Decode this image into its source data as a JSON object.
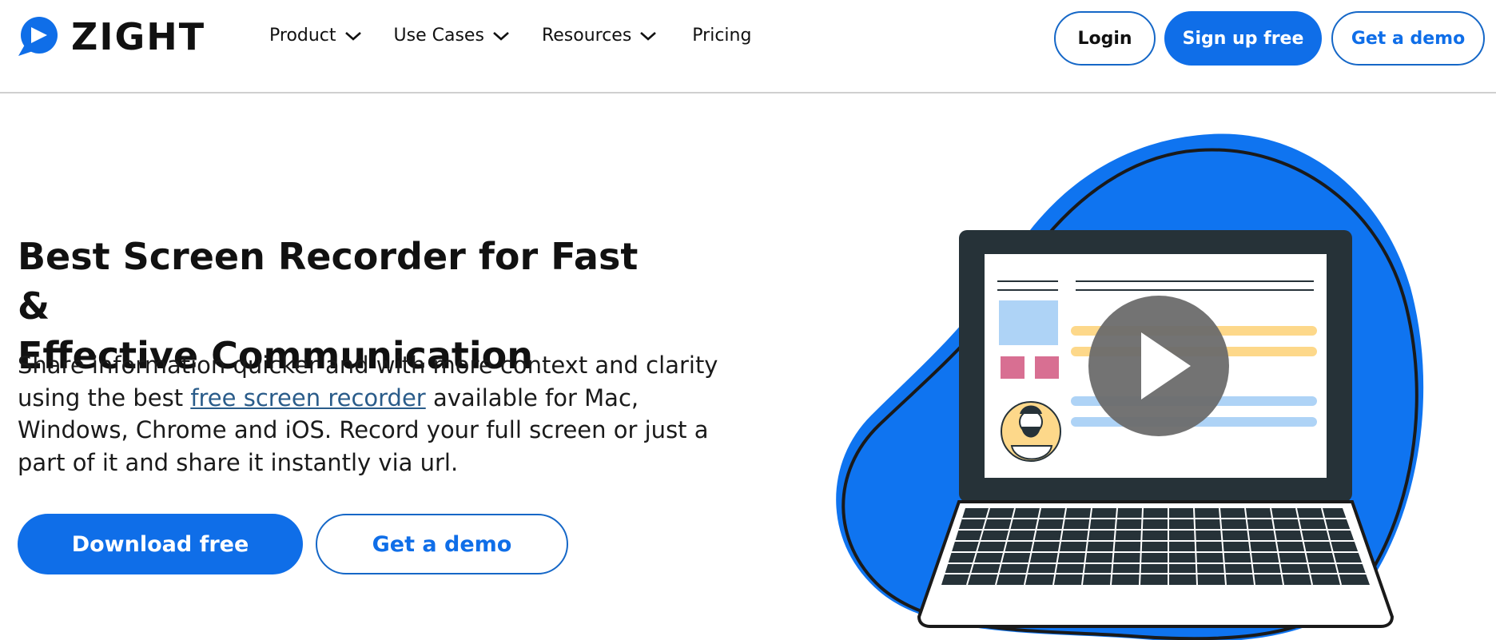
{
  "brand": {
    "name": "ZIGHT",
    "color": "#0f6ee8"
  },
  "nav": {
    "items": [
      {
        "label": "Product",
        "has_dropdown": true
      },
      {
        "label": "Use Cases",
        "has_dropdown": true
      },
      {
        "label": "Resources",
        "has_dropdown": true
      },
      {
        "label": "Pricing",
        "has_dropdown": false
      }
    ]
  },
  "header_buttons": {
    "login": "Login",
    "signup": "Sign up free",
    "demo": "Get a demo"
  },
  "hero": {
    "headline_line1": "Best Screen Recorder for Fast &",
    "headline_line2": "Effective Communication",
    "sub_before": "Share information quicker and with more context and clarity using the best ",
    "sub_link": "free screen recorder",
    "sub_after": " available for Mac, Windows, Chrome and iOS. Record your full screen or just a part of it and share it instantly via url.",
    "primary_cta": "Download free",
    "secondary_cta": "Get a demo"
  },
  "illustration": {
    "icons": [
      "laptop-illustration",
      "play-icon",
      "avatar-icon"
    ],
    "colors": {
      "blob": "#0f74f0",
      "laptop": "#263238",
      "play": "#6b6b6b"
    }
  }
}
